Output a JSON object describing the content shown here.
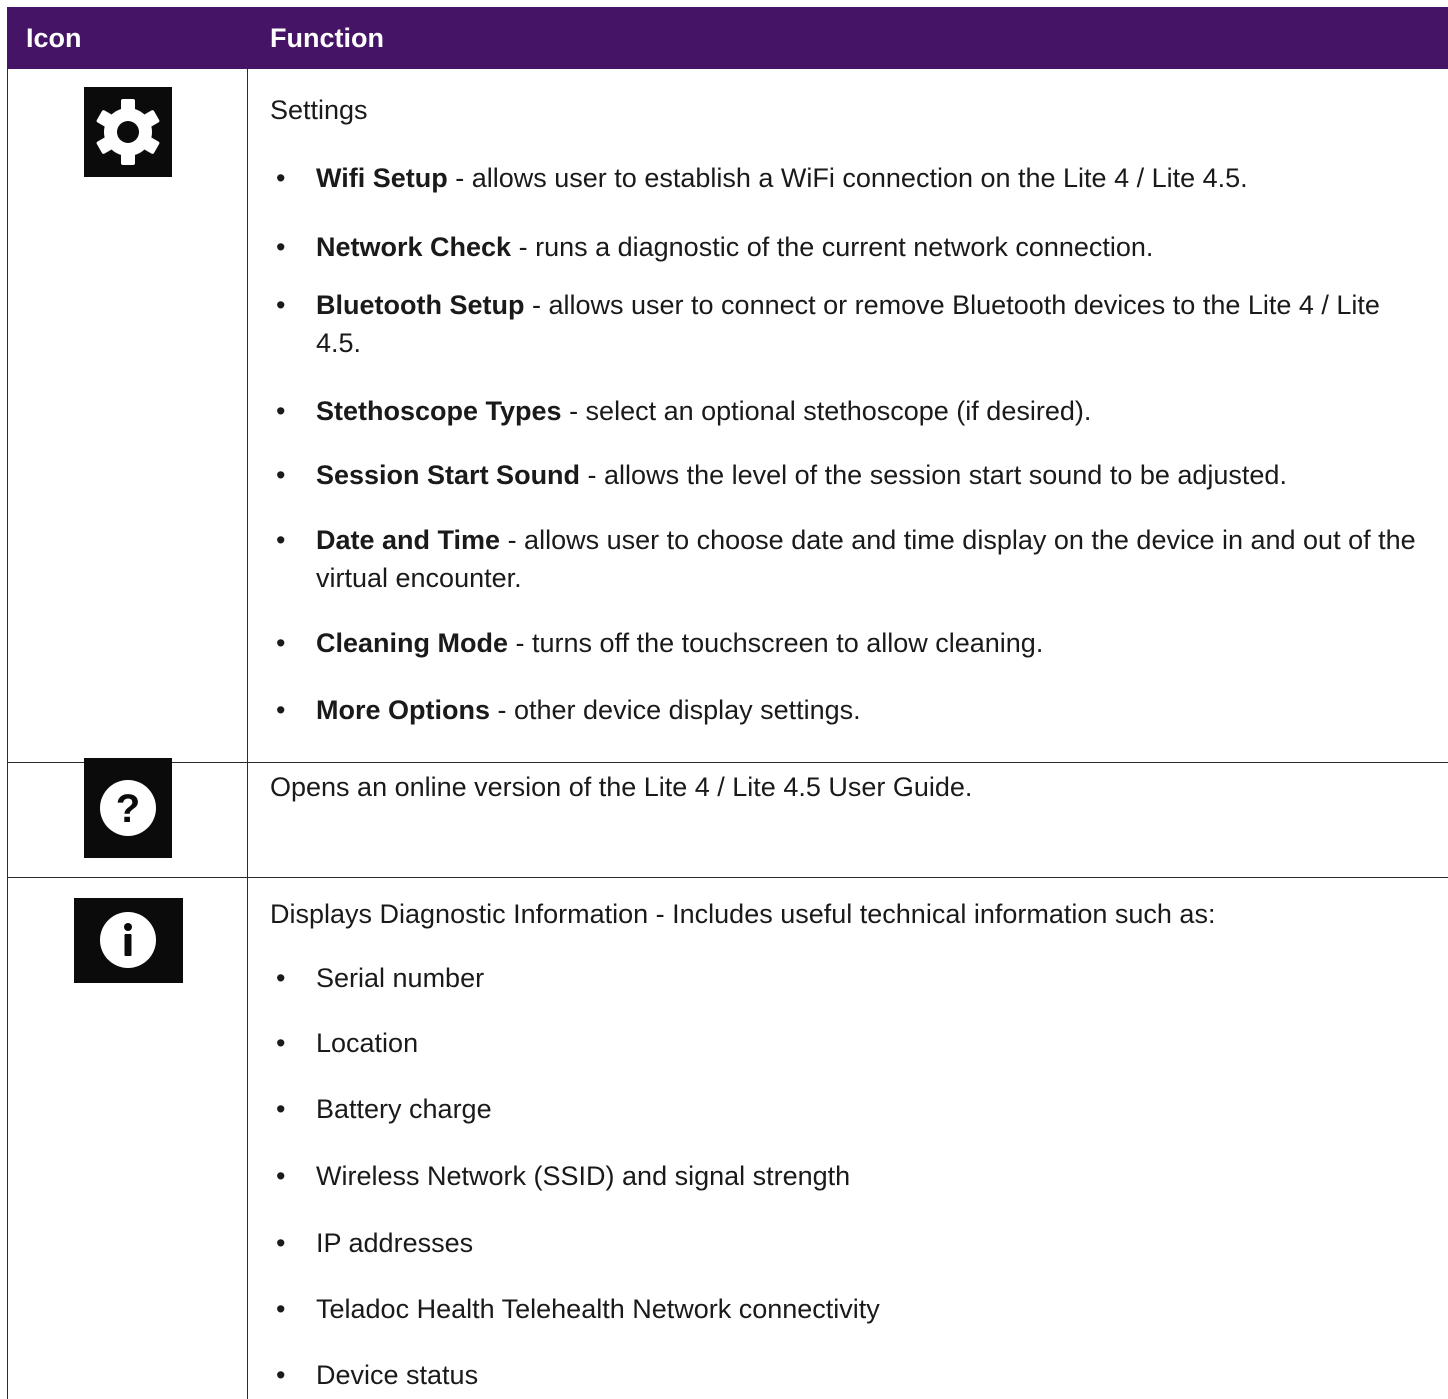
{
  "header": {
    "icon_label": "Icon",
    "function_label": "Function"
  },
  "colors": {
    "header_bg": "#451466",
    "header_text": "#ffffff",
    "icon_bg": "#0b0b0b"
  },
  "rows": [
    {
      "icon": "gear-icon",
      "title": "Settings",
      "items": [
        {
          "term": "Wifi Setup",
          "desc": " - allows user to establish a WiFi connection on the Lite 4 / Lite 4.5."
        },
        {
          "term": "Network Check",
          "desc": " - runs a diagnostic of the current network connection."
        },
        {
          "term": "Bluetooth Setup",
          "desc": " - allows user to connect or remove Bluetooth devices to the Lite 4 / Lite 4.5."
        },
        {
          "term": "Stethoscope Types",
          "desc": " - select an optional stethoscope (if desired)."
        },
        {
          "term": "Session Start Sound",
          "desc": " - allows the level of the session start sound to be adjusted."
        },
        {
          "term": "Date and Time",
          "desc": " - allows user to choose date and time display on the device in and out of the virtual encounter."
        },
        {
          "term": "Cleaning Mode",
          "desc": " - turns off the touchscreen to allow cleaning."
        },
        {
          "term": "More Options",
          "desc": " - other device display settings."
        }
      ]
    },
    {
      "icon": "help-icon",
      "title": "Opens an online version of the Lite 4 / Lite 4.5 User Guide."
    },
    {
      "icon": "info-icon",
      "title": "Displays Diagnostic Information - Includes useful technical information such as:",
      "items": [
        "Serial number",
        "Location",
        "Battery charge",
        "Wireless Network (SSID) and signal strength",
        "IP addresses",
        "Teladoc Health Telehealth Network connectivity",
        "Device status"
      ]
    }
  ]
}
